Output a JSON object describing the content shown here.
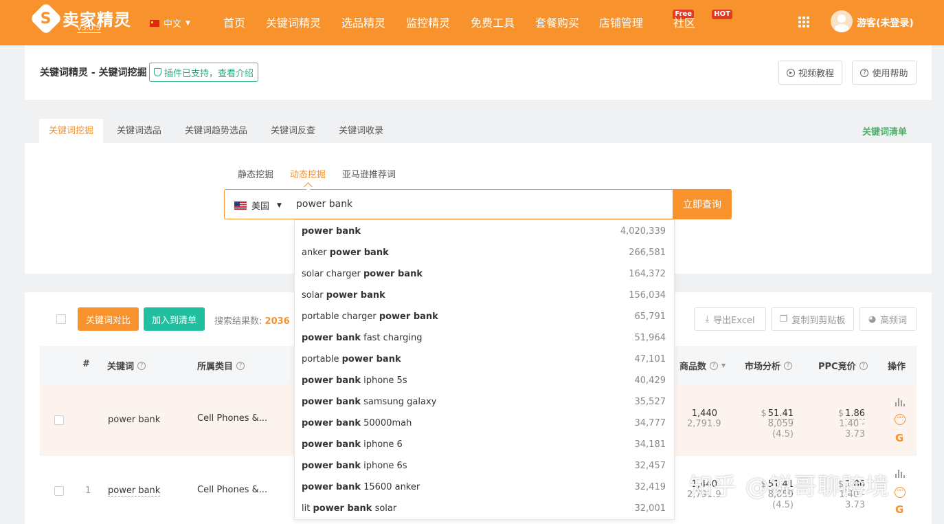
{
  "header": {
    "logo_mark": "S",
    "logo_text": "卖家精灵",
    "version": "v3.0.5",
    "language": "中文",
    "nav": [
      {
        "label": "首页"
      },
      {
        "label": "关键词精灵"
      },
      {
        "label": "选品精灵"
      },
      {
        "label": "监控精灵"
      },
      {
        "label": "免费工具"
      },
      {
        "label": "套餐购买"
      },
      {
        "label": "店铺管理",
        "badge": "Free"
      },
      {
        "label": "社区",
        "badge": "HOT"
      }
    ],
    "user": "游客(未登录)"
  },
  "page": {
    "breadcrumb": "关键词精灵 - 关键词挖掘",
    "plugin_tag": "插件已支持，查看介绍",
    "video_btn": "视频教程",
    "help_btn": "使用帮助"
  },
  "tabs": [
    {
      "label": "关键词挖掘"
    },
    {
      "label": "关键词选品"
    },
    {
      "label": "关键词趋势选品"
    },
    {
      "label": "关键词反查"
    },
    {
      "label": "关键词收录"
    }
  ],
  "tab_right": "关键词清单",
  "search": {
    "subtabs": [
      "静态挖掘",
      "动态挖掘",
      "亚马逊推荐词"
    ],
    "country": "美国",
    "value": "power bank",
    "button": "立即查询"
  },
  "suggestions": [
    {
      "pre": "",
      "bold": "power bank",
      "post": "",
      "count": "4,020,339"
    },
    {
      "pre": "anker ",
      "bold": "power bank",
      "post": "",
      "count": "266,581"
    },
    {
      "pre": "solar charger ",
      "bold": "power bank",
      "post": "",
      "count": "164,372"
    },
    {
      "pre": "solar ",
      "bold": "power bank",
      "post": "",
      "count": "156,034"
    },
    {
      "pre": "portable charger ",
      "bold": "power bank",
      "post": "",
      "count": "65,791"
    },
    {
      "pre": "",
      "bold": "power bank",
      "post": " fast charging",
      "count": "51,964"
    },
    {
      "pre": "portable ",
      "bold": "power bank",
      "post": "",
      "count": "47,101"
    },
    {
      "pre": "",
      "bold": "power bank",
      "post": " iphone 5s",
      "count": "40,429"
    },
    {
      "pre": "",
      "bold": "power bank",
      "post": " samsung galaxy",
      "count": "35,527"
    },
    {
      "pre": "",
      "bold": "power bank",
      "post": " 50000mah",
      "count": "34,777"
    },
    {
      "pre": "",
      "bold": "power bank",
      "post": " iphone 6",
      "count": "34,181"
    },
    {
      "pre": "",
      "bold": "power bank",
      "post": " iphone 6s",
      "count": "32,457"
    },
    {
      "pre": "",
      "bold": "power bank",
      "post": " 15600 anker",
      "count": "32,419"
    },
    {
      "pre": "lit ",
      "bold": "power bank",
      "post": " solar",
      "count": "32,001"
    }
  ],
  "results": {
    "compare_btn": "关键词对比",
    "add_btn": "加入到清单",
    "count_label": "搜索结果数:",
    "count": "2036",
    "export_btn": "导出Excel",
    "copy_btn": "复制到剪贴板",
    "freq_btn": "高频词",
    "columns": {
      "index": "#",
      "keyword": "关键词",
      "category": "所属类目",
      "products": "商品数",
      "market": "市场分析",
      "ppc": "PPC竞价",
      "actions": "操作"
    },
    "rows": [
      {
        "index": "",
        "keyword": "power bank",
        "category": "Cell Phones &...",
        "products": "1,440",
        "products_sub": "2,791.9",
        "dollar": "$",
        "market": "51.41",
        "market_sub": "8,059 (4.5)",
        "ppc": "1.86",
        "ppc_sub": "1.40 - 3.73"
      },
      {
        "index": "1",
        "keyword": "power bank",
        "category": "Cell Phones &...",
        "products": "1,440",
        "products_sub": "2,791.9",
        "dollar": "$",
        "market": "51.41",
        "market_sub": "8,059 (4.5)",
        "ppc": "1.86",
        "ppc_sub": "1.40 - 3.73"
      }
    ]
  },
  "watermark": "知乎 @锐哥聊跨境",
  "colors": {
    "brand": "#f7922d",
    "green": "#3cbf95",
    "teal": "#1fbfa0"
  }
}
